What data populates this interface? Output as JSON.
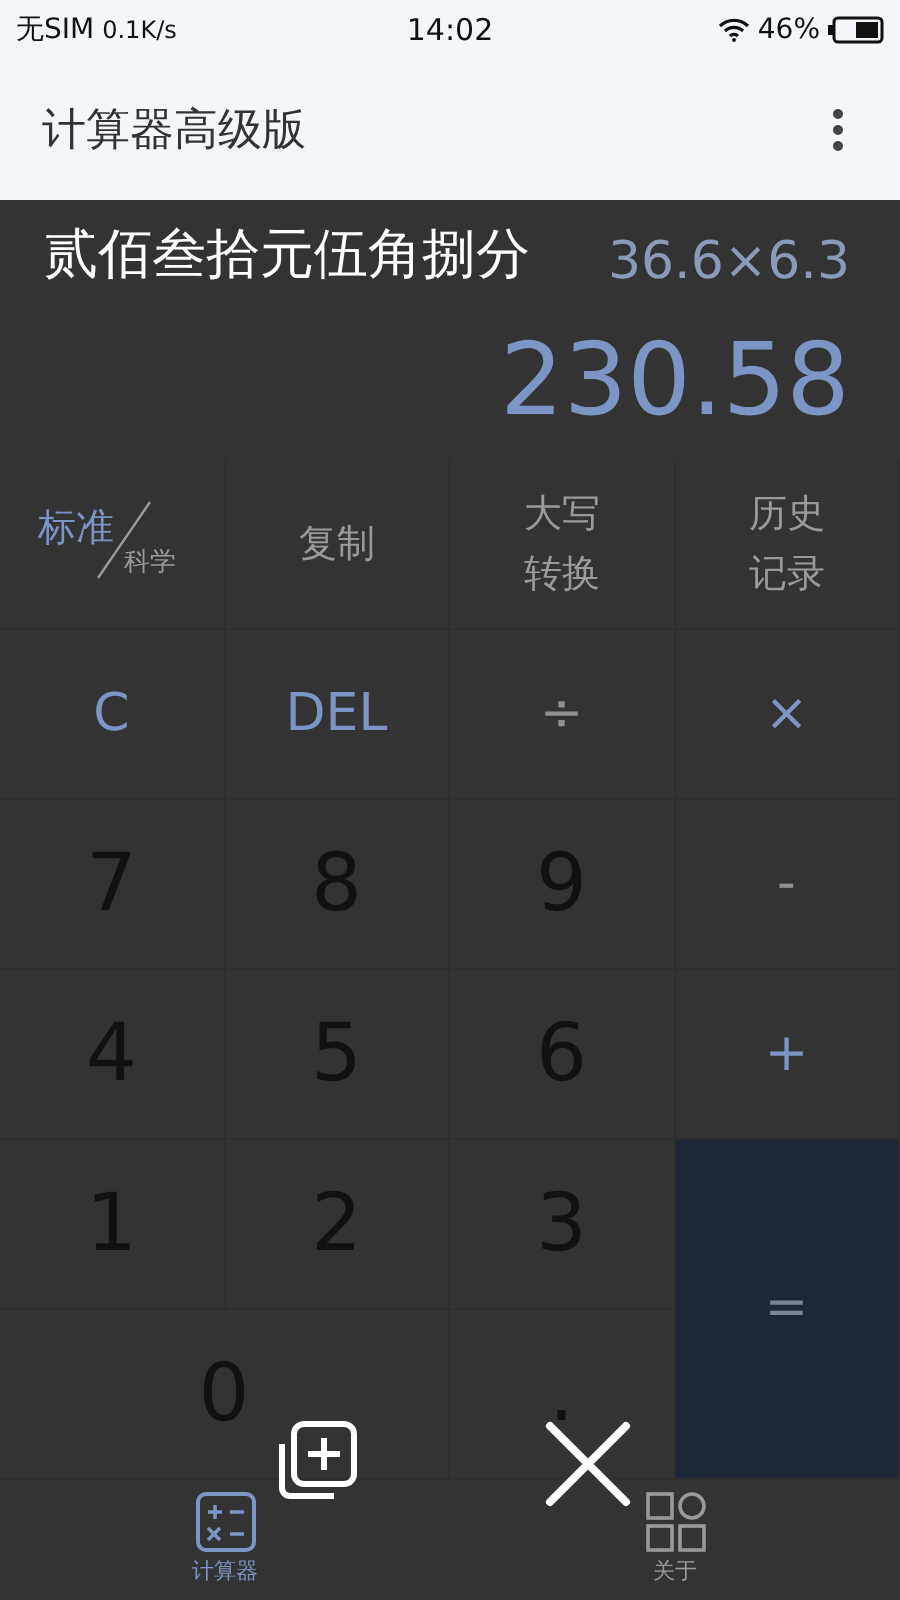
{
  "status_bar": {
    "carrier": "无SIM",
    "speed": "0.1K/s",
    "time": "14:02",
    "battery": "46%"
  },
  "app_bar": {
    "title": "计算器高级版"
  },
  "display": {
    "expression": "36.6×6.3",
    "result": "230.58"
  },
  "overlay": {
    "text": "贰佰叁拾元伍角捌分"
  },
  "modes": [
    {
      "label": "标准",
      "selected": true
    },
    {
      "label": "科学",
      "selected": false
    }
  ],
  "functions": [
    "复制",
    "大写转换",
    "历史记录"
  ],
  "keys": [
    {
      "label": "C",
      "kind": "function"
    },
    {
      "label": "DEL",
      "kind": "function"
    },
    {
      "label": "÷",
      "kind": "operator"
    },
    {
      "label": "×",
      "kind": "function"
    },
    {
      "label": "7",
      "kind": "digit"
    },
    {
      "label": "8",
      "kind": "digit"
    },
    {
      "label": "9",
      "kind": "digit"
    },
    {
      "label": "-",
      "kind": "operator"
    },
    {
      "label": "4",
      "kind": "digit"
    },
    {
      "label": "5",
      "kind": "digit"
    },
    {
      "label": "6",
      "kind": "digit"
    },
    {
      "label": "+",
      "kind": "function"
    },
    {
      "label": "1",
      "kind": "digit"
    },
    {
      "label": "2",
      "kind": "digit"
    },
    {
      "label": "3",
      "kind": "digit"
    },
    {
      "label": "=",
      "kind": "equals"
    },
    {
      "label": "0",
      "kind": "wide"
    },
    {
      "label": ".",
      "kind": "digit"
    }
  ],
  "nav": [
    {
      "label": "计算器",
      "selected": true
    },
    {
      "label": "关于",
      "selected": false
    }
  ]
}
